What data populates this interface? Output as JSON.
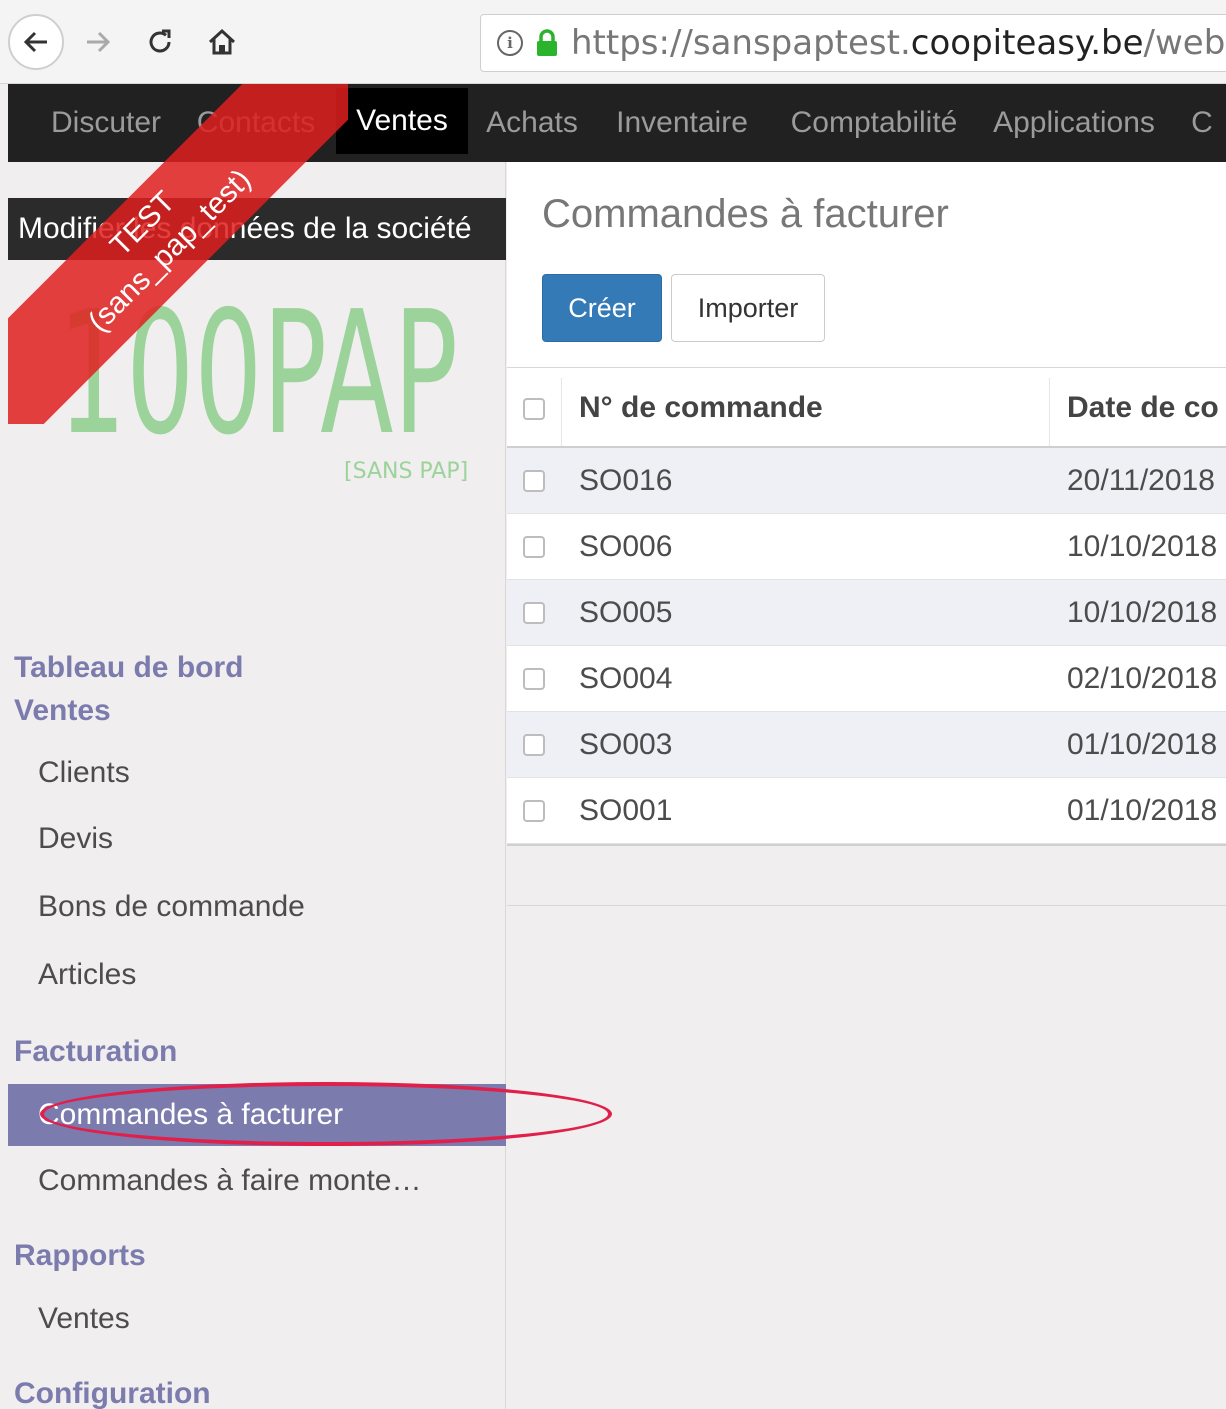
{
  "browser": {
    "url_prefix": "https://sanspaptest.",
    "url_domain": "coopiteasy.be",
    "url_suffix": "/web"
  },
  "topmenu": {
    "items": [
      "Discuter",
      "Contacts",
      "Ventes",
      "Achats",
      "Inventaire",
      "Comptabilité",
      "Applications",
      "C"
    ],
    "active": "Ventes"
  },
  "ribbon": {
    "line1": "TEST",
    "line2": "(sans_pap_test)"
  },
  "sidebar": {
    "company_bar": "Modifier les données de la société",
    "logo_main": "100PAP",
    "logo_sub": "[SANS PAP]",
    "sections": [
      {
        "title": "Tableau de bord Ventes",
        "items": [
          "Clients",
          "Devis",
          "Bons de commande",
          "Articles"
        ]
      },
      {
        "title": "Facturation",
        "items": [
          "Commandes à facturer",
          "Commandes à faire monte…"
        ]
      },
      {
        "title": "Rapports",
        "items": [
          "Ventes"
        ]
      },
      {
        "title": "Configuration",
        "items": []
      }
    ],
    "active_item": "Commandes à facturer"
  },
  "main": {
    "title": "Commandes à facturer",
    "create_label": "Créer",
    "import_label": "Importer",
    "columns": [
      "N° de commande",
      "Date de co"
    ],
    "rows": [
      {
        "number": "SO016",
        "date": "20/11/2018"
      },
      {
        "number": "SO006",
        "date": "10/10/2018"
      },
      {
        "number": "SO005",
        "date": "10/10/2018"
      },
      {
        "number": "SO004",
        "date": "02/10/2018"
      },
      {
        "number": "SO003",
        "date": "01/10/2018"
      },
      {
        "number": "SO001",
        "date": "01/10/2018"
      }
    ]
  },
  "colors": {
    "accent": "#7c7bad",
    "primary_button": "#337ab7",
    "annotation": "#e0204a",
    "ribbon": "#e11e1e"
  }
}
